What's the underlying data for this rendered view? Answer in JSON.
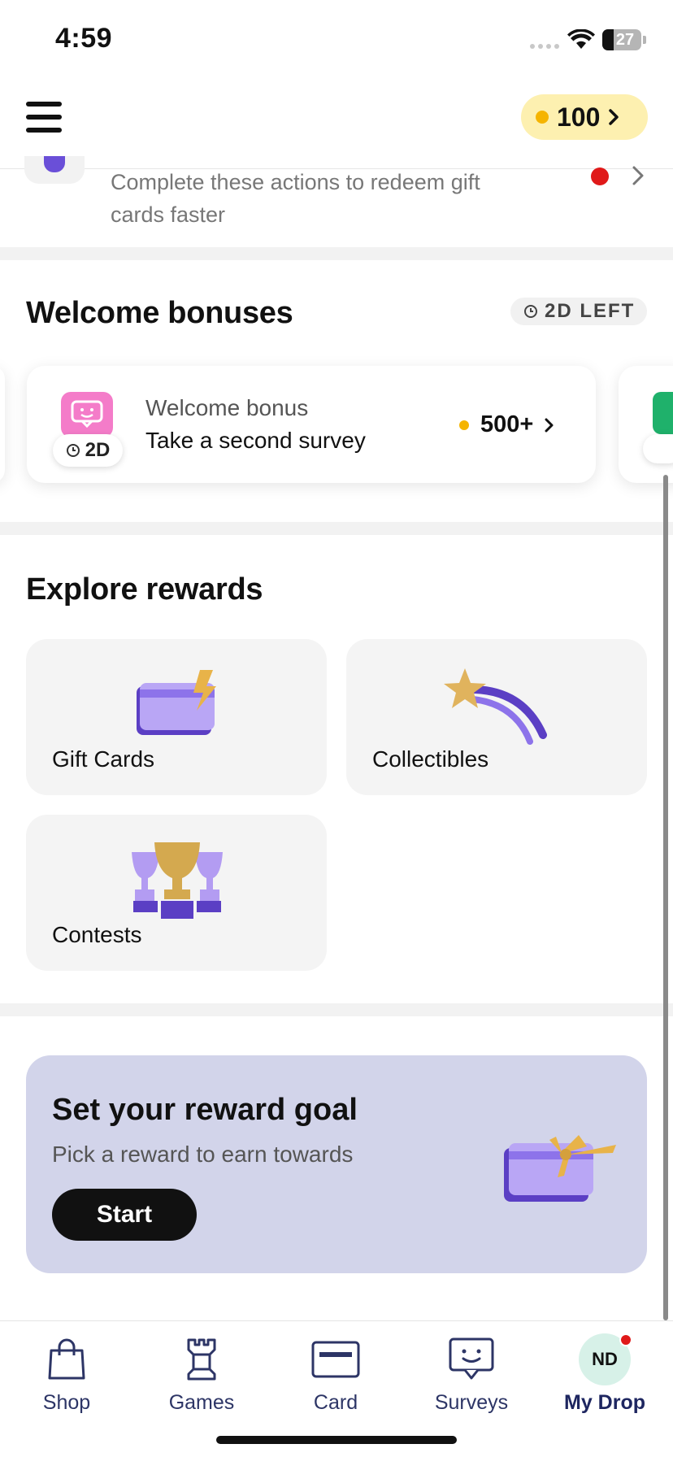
{
  "status_bar": {
    "time": "4:59",
    "battery": "27"
  },
  "header": {
    "points": "100"
  },
  "banner": {
    "text": "Complete these actions to redeem gift cards faster"
  },
  "welcome": {
    "title": "Welcome bonuses",
    "days_left": "2D LEFT",
    "card": {
      "label": "Welcome bonus",
      "subtitle": "Take a second survey",
      "points": "500+",
      "timer": "2D"
    }
  },
  "explore": {
    "title": "Explore rewards",
    "tiles": [
      {
        "label": "Gift Cards"
      },
      {
        "label": "Collectibles"
      },
      {
        "label": "Contests"
      }
    ]
  },
  "goal": {
    "title": "Set your reward goal",
    "subtitle": "Pick a reward to earn towards",
    "button": "Start"
  },
  "nav": {
    "items": [
      {
        "label": "Shop"
      },
      {
        "label": "Games"
      },
      {
        "label": "Card"
      },
      {
        "label": "Surveys"
      },
      {
        "label": "My Drop",
        "avatar": "ND"
      }
    ]
  },
  "colors": {
    "coin": "#f5b400",
    "points_pill": "#fdf0b0",
    "goal_card": "#d2d4ea",
    "nav_text": "#2d3566",
    "notification_dot": "#e01919"
  }
}
